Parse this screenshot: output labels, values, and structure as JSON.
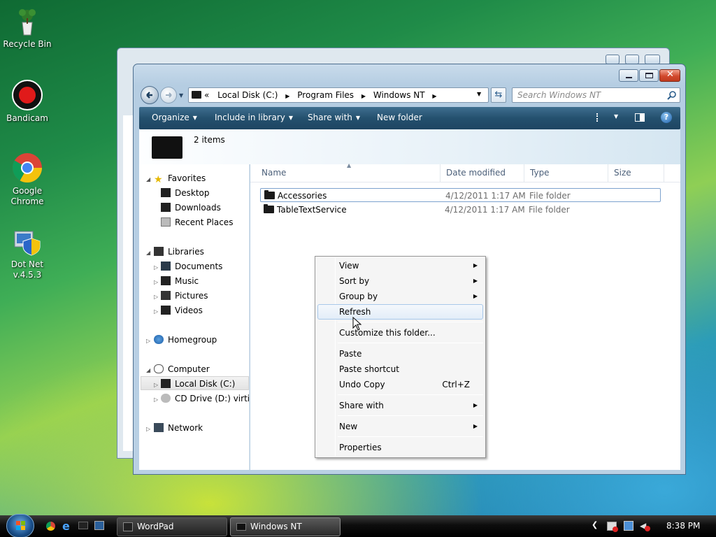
{
  "desktop": {
    "icons": [
      {
        "label_line1": "Recycle Bin",
        "label_line2": ""
      },
      {
        "label_line1": "Bandicam",
        "label_line2": ""
      },
      {
        "label_line1": "Google",
        "label_line2": "Chrome"
      },
      {
        "label_line1": "Dot Net",
        "label_line2": "v.4.5.3"
      }
    ]
  },
  "window": {
    "address": {
      "prefix": "«",
      "crumbs": [
        "Local Disk (C:)",
        "Program Files",
        "Windows NT"
      ]
    },
    "search_placeholder": "Search Windows NT",
    "toolbar": {
      "organize": "Organize",
      "include_in_library": "Include in library",
      "share_with": "Share with",
      "new_folder": "New folder"
    },
    "details": {
      "count": "2 items"
    },
    "nav": {
      "favorites": "Favorites",
      "desktop": "Desktop",
      "downloads": "Downloads",
      "recent_places": "Recent Places",
      "libraries": "Libraries",
      "documents": "Documents",
      "music": "Music",
      "pictures": "Pictures",
      "videos": "Videos",
      "homegroup": "Homegroup",
      "computer": "Computer",
      "local_disk": "Local Disk (C:)",
      "cd_drive": "CD Drive (D:) virtio-v",
      "network": "Network"
    },
    "columns": {
      "name": "Name",
      "date": "Date modified",
      "type": "Type",
      "size": "Size"
    },
    "files": [
      {
        "name": "Accessories",
        "date": "4/12/2011 1:17 AM",
        "type": "File folder"
      },
      {
        "name": "TableTextService",
        "date": "4/12/2011 1:17 AM",
        "type": "File folder"
      }
    ]
  },
  "context_menu": {
    "view": "View",
    "sort_by": "Sort by",
    "group_by": "Group by",
    "refresh": "Refresh",
    "customize": "Customize this folder...",
    "paste": "Paste",
    "paste_shortcut": "Paste shortcut",
    "undo_copy": "Undo Copy",
    "undo_shortcut": "Ctrl+Z",
    "share_with": "Share with",
    "new": "New",
    "properties": "Properties"
  },
  "taskbar": {
    "buttons": [
      "WordPad",
      "Windows NT"
    ],
    "clock": "8:38 PM"
  },
  "colors": {
    "toolbar": "#24506e",
    "menu_highlight": "#a8c8ea",
    "close_button": "#d24a2d"
  }
}
